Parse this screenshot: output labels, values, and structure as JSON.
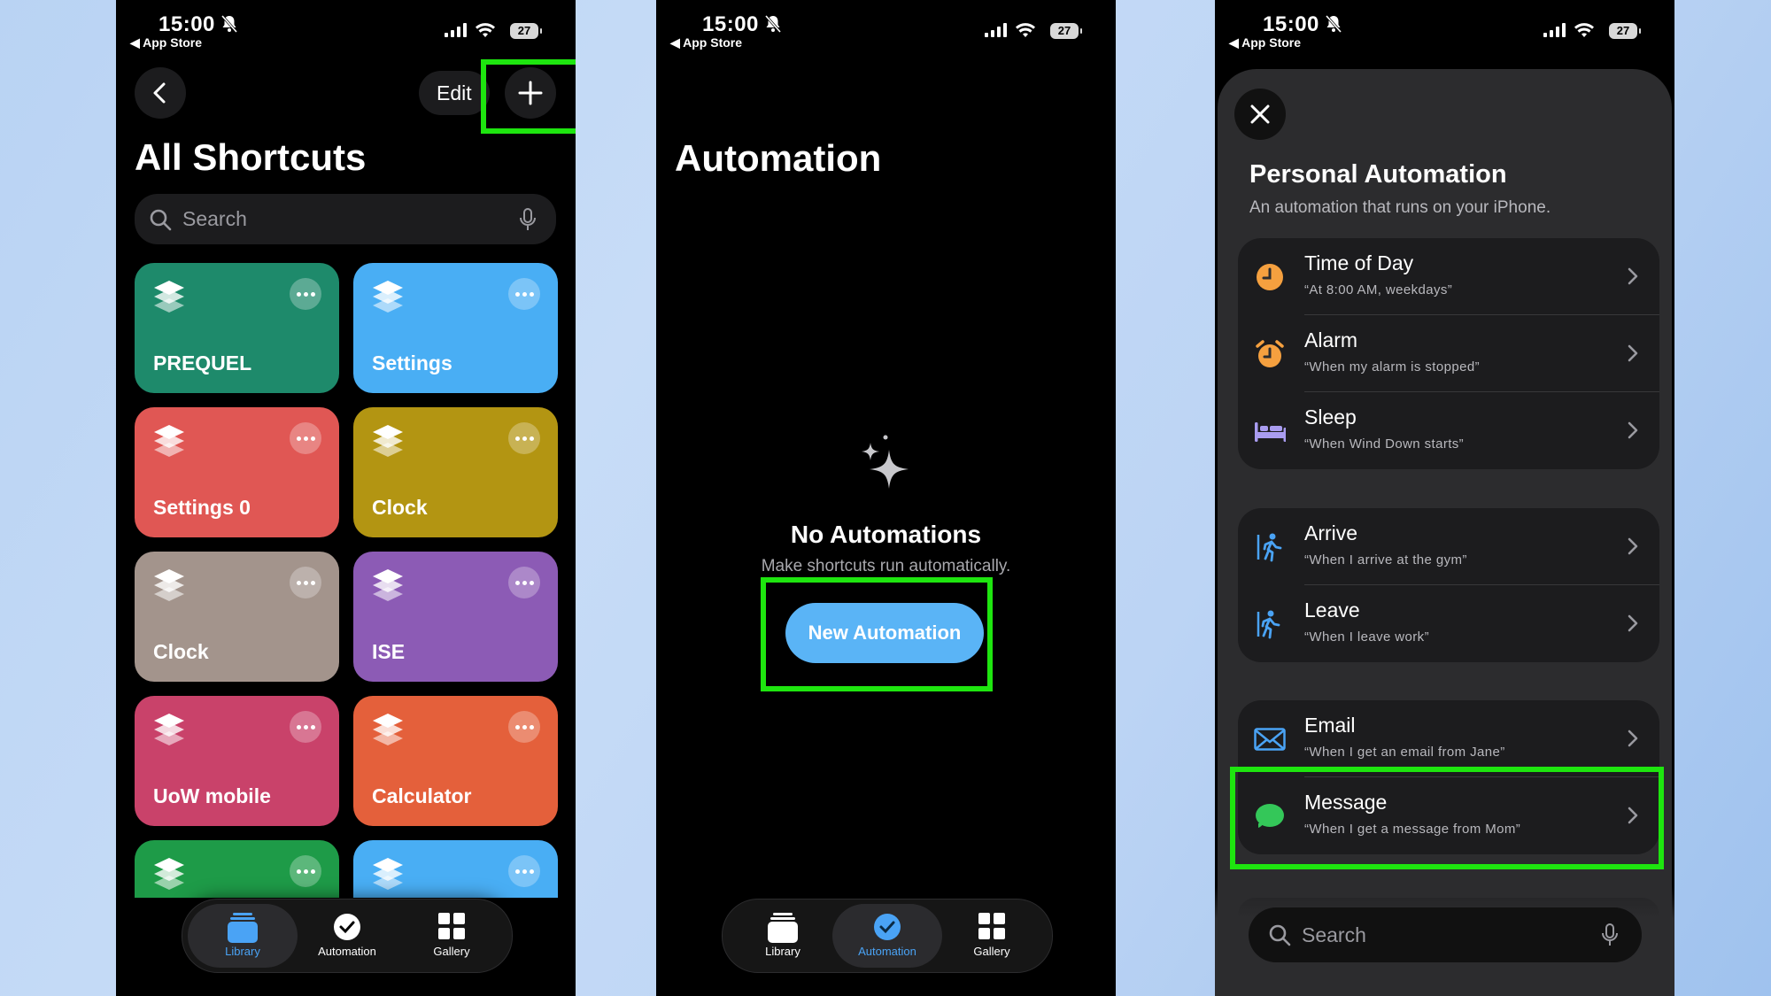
{
  "status": {
    "time": "15:00",
    "back_app": "◀ App Store",
    "battery": "27"
  },
  "library": {
    "edit_label": "Edit",
    "title": "All Shortcuts",
    "search_placeholder": "Search",
    "tiles": [
      {
        "name": "PREQUEL",
        "color": "#1e8a6b"
      },
      {
        "name": "Settings",
        "color": "#49aef4"
      },
      {
        "name": "Settings 0",
        "color": "#e05754"
      },
      {
        "name": "Clock",
        "color": "#b39512"
      },
      {
        "name": "Clock",
        "color": "#a3948c"
      },
      {
        "name": "ISE",
        "color": "#8c5bb5"
      },
      {
        "name": "UoW mobile",
        "color": "#c9426a"
      },
      {
        "name": "Calculator",
        "color": "#e4603b"
      },
      {
        "name": "",
        "color": "#1e9b48"
      },
      {
        "name": "",
        "color": "#49aef4"
      }
    ]
  },
  "tabs": {
    "library": "Library",
    "automation": "Automation",
    "gallery": "Gallery"
  },
  "automation": {
    "title": "Automation",
    "empty_title": "No Automations",
    "empty_subtitle": "Make shortcuts run automatically.",
    "new_button": "New Automation"
  },
  "personal": {
    "title": "Personal Automation",
    "subtitle": "An automation that runs on your iPhone.",
    "groups": [
      [
        {
          "title": "Time of Day",
          "subtitle": "“At 8:00 AM, weekdays”",
          "icon": "clock-icon",
          "color": "#f5a03f"
        },
        {
          "title": "Alarm",
          "subtitle": "“When my alarm is stopped”",
          "icon": "alarm-icon",
          "color": "#f5a03f"
        },
        {
          "title": "Sleep",
          "subtitle": "“When Wind Down starts”",
          "icon": "bed-icon",
          "color": "#a99cf0"
        }
      ],
      [
        {
          "title": "Arrive",
          "subtitle": "“When I arrive at the gym”",
          "icon": "walk-arrive-icon",
          "color": "#4aa3f5"
        },
        {
          "title": "Leave",
          "subtitle": "“When I leave work”",
          "icon": "walk-leave-icon",
          "color": "#4aa3f5"
        }
      ],
      [
        {
          "title": "Email",
          "subtitle": "“When I get an email from Jane”",
          "icon": "envelope-icon",
          "color": "#4aa3f5"
        },
        {
          "title": "Message",
          "subtitle": "“When I get a message from Mom”",
          "icon": "message-icon",
          "color": "#34c759"
        }
      ]
    ],
    "search_placeholder": "Search"
  },
  "colors": {
    "highlight": "#1ee50f",
    "accent_blue": "#4aa3f5"
  }
}
